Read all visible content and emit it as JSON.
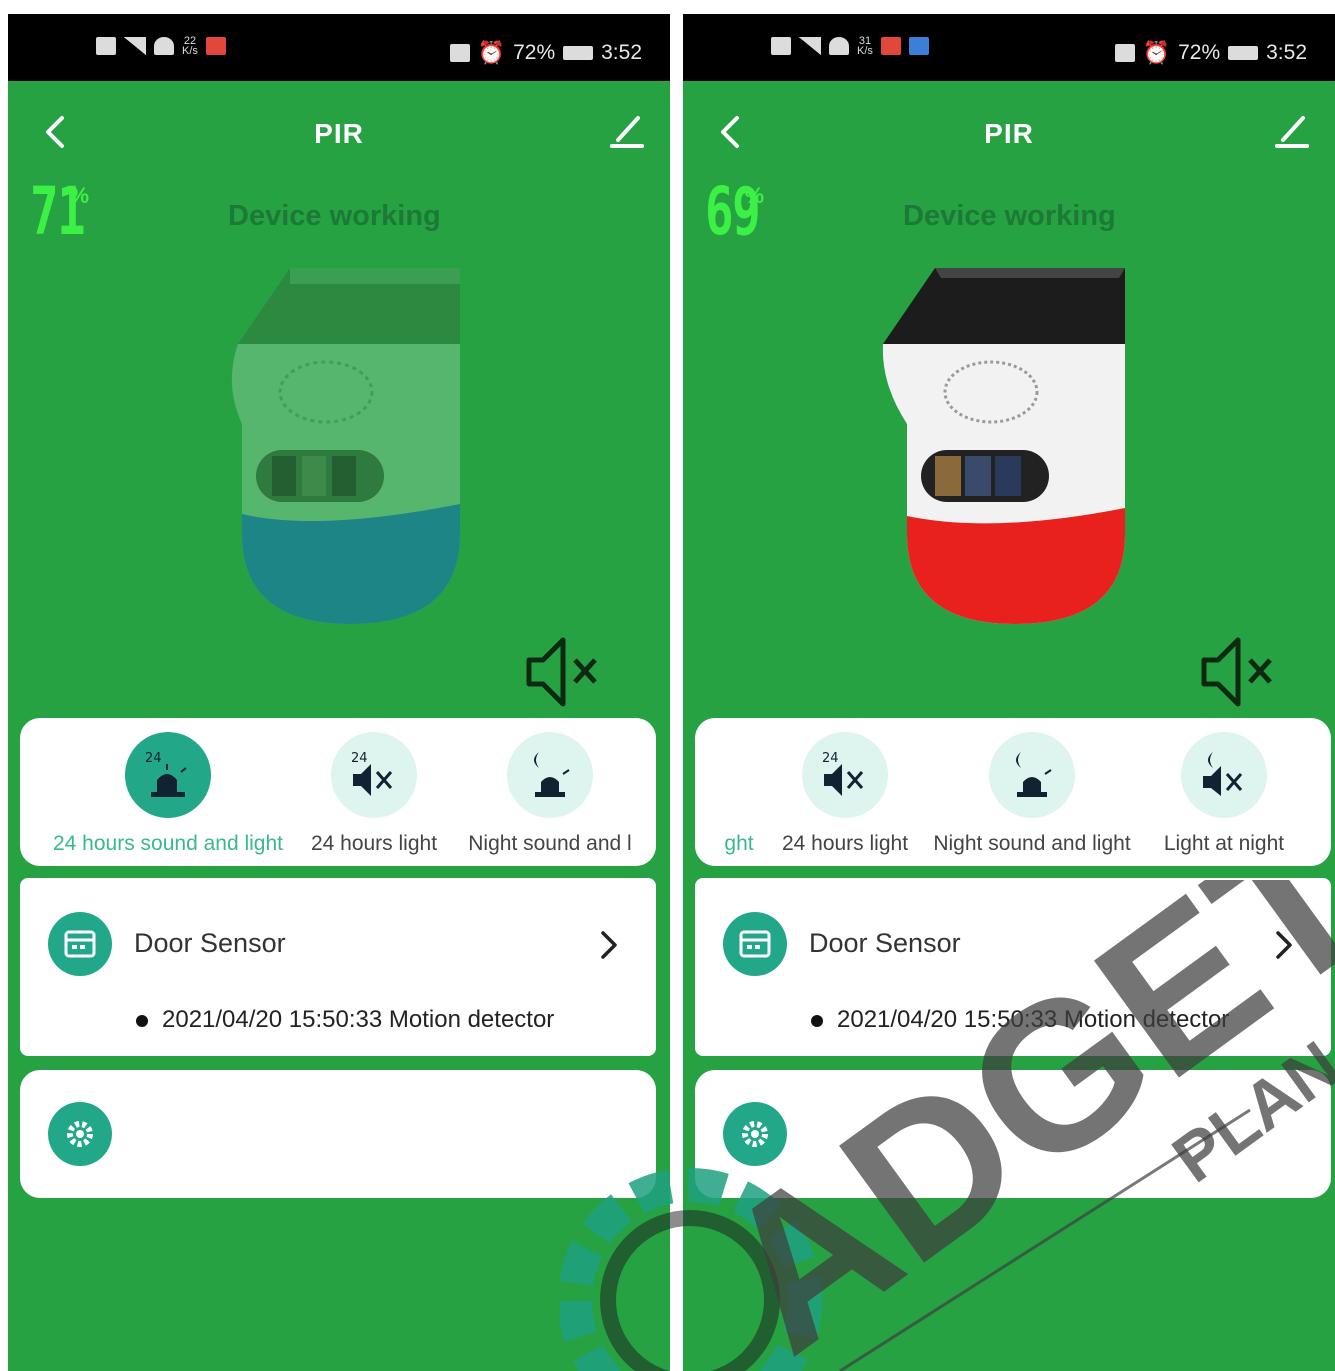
{
  "left": {
    "title": "PIR",
    "battery": "71",
    "battery_unit": "%",
    "status": "Device working",
    "modes": [
      {
        "label": "24 hours sound and light",
        "active": true
      },
      {
        "label": "24 hours light",
        "active": false
      },
      {
        "label": "Night sound and l",
        "active": false
      }
    ],
    "sensor": {
      "title": "Door Sensor",
      "log": "2021/04/20 15:50:33 Motion detector"
    },
    "statusbar": {
      "speed_top": "22",
      "speed_bottom": "K/s",
      "battery": "72%",
      "time": "3:52"
    }
  },
  "right": {
    "title": "PIR",
    "battery": "69",
    "battery_unit": "%",
    "status": "Device working",
    "modes": [
      {
        "label": "ght",
        "active": true
      },
      {
        "label": "24 hours light",
        "active": false
      },
      {
        "label": "Night sound and light",
        "active": false
      },
      {
        "label": "Light at night",
        "active": false
      }
    ],
    "sensor": {
      "title": "Door Sensor",
      "log": "2021/04/20 15:50:33 Motion detector"
    },
    "statusbar": {
      "speed_top": "31",
      "speed_bottom": "K/s",
      "battery": "72%",
      "time": "3:52"
    }
  },
  "watermark": {
    "text_main": "ADGET",
    "text_sub": "PLAN"
  },
  "colors": {
    "app_bg": "#27a243",
    "battery_text": "#3cf046",
    "accent_teal": "#22a789",
    "status_text": "#1a7a36",
    "siren_red": "#e8211e"
  },
  "icons": [
    "back-icon",
    "edit-icon",
    "mute-icon",
    "siren-icon",
    "calendar-icon",
    "gear-icon",
    "chevron-right-icon"
  ]
}
